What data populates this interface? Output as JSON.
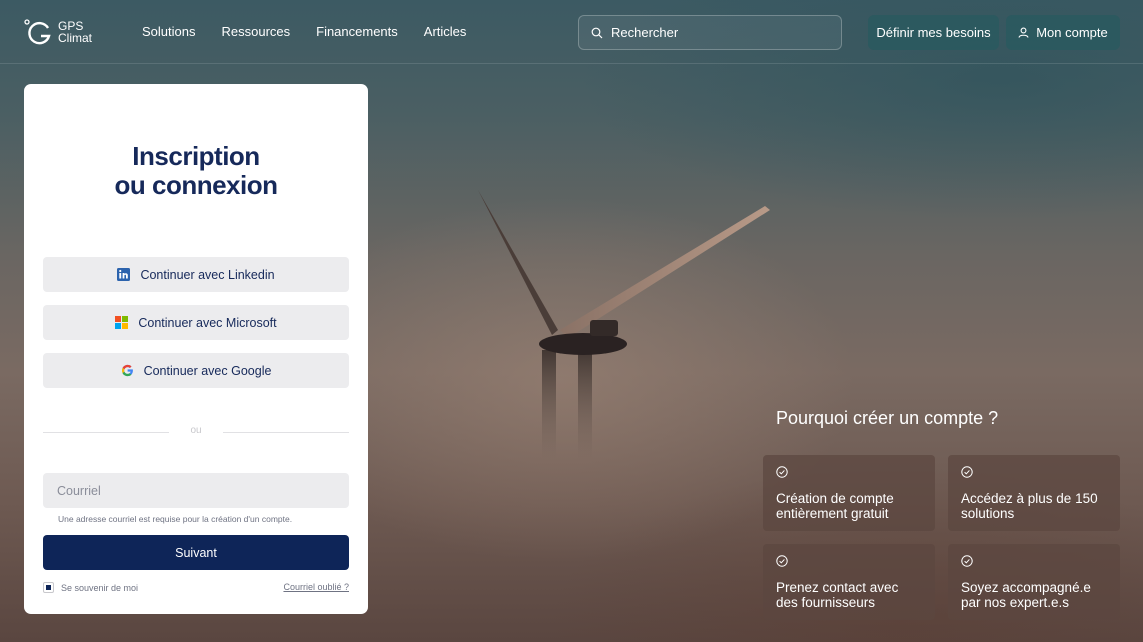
{
  "brand": {
    "name_line1": "GPS",
    "name_line2": "Climat"
  },
  "nav": [
    {
      "label": "Solutions"
    },
    {
      "label": "Ressources"
    },
    {
      "label": "Financements"
    },
    {
      "label": "Articles"
    }
  ],
  "search": {
    "placeholder": "Rechercher"
  },
  "header_buttons": {
    "needs": "Définir mes besoins",
    "account": "Mon compte"
  },
  "login": {
    "title_line1": "Inscription",
    "title_line2": "ou connexion",
    "linkedin": "Continuer avec Linkedin",
    "microsoft": "Continuer avec Microsoft",
    "google": "Continuer avec Google",
    "or": "ou",
    "email_placeholder": "Courriel",
    "email_hint": "Une adresse courriel est requise pour la création d'un compte.",
    "submit": "Suivant",
    "remember": "Se souvenir de moi",
    "forgot": "Courriel oublié ?"
  },
  "why": {
    "title": "Pourquoi créer un compte ?",
    "benefits": [
      {
        "text": "Création de compte entièrement gratuit"
      },
      {
        "text": "Accédez à plus de 150 solutions"
      },
      {
        "text": "Prenez contact avec des fournisseurs"
      },
      {
        "text": "Soyez accompagné.e par nos expert.e.s"
      }
    ]
  },
  "colors": {
    "primary": "#0e2558",
    "header_button": "#285a5f",
    "title": "#16295a"
  }
}
